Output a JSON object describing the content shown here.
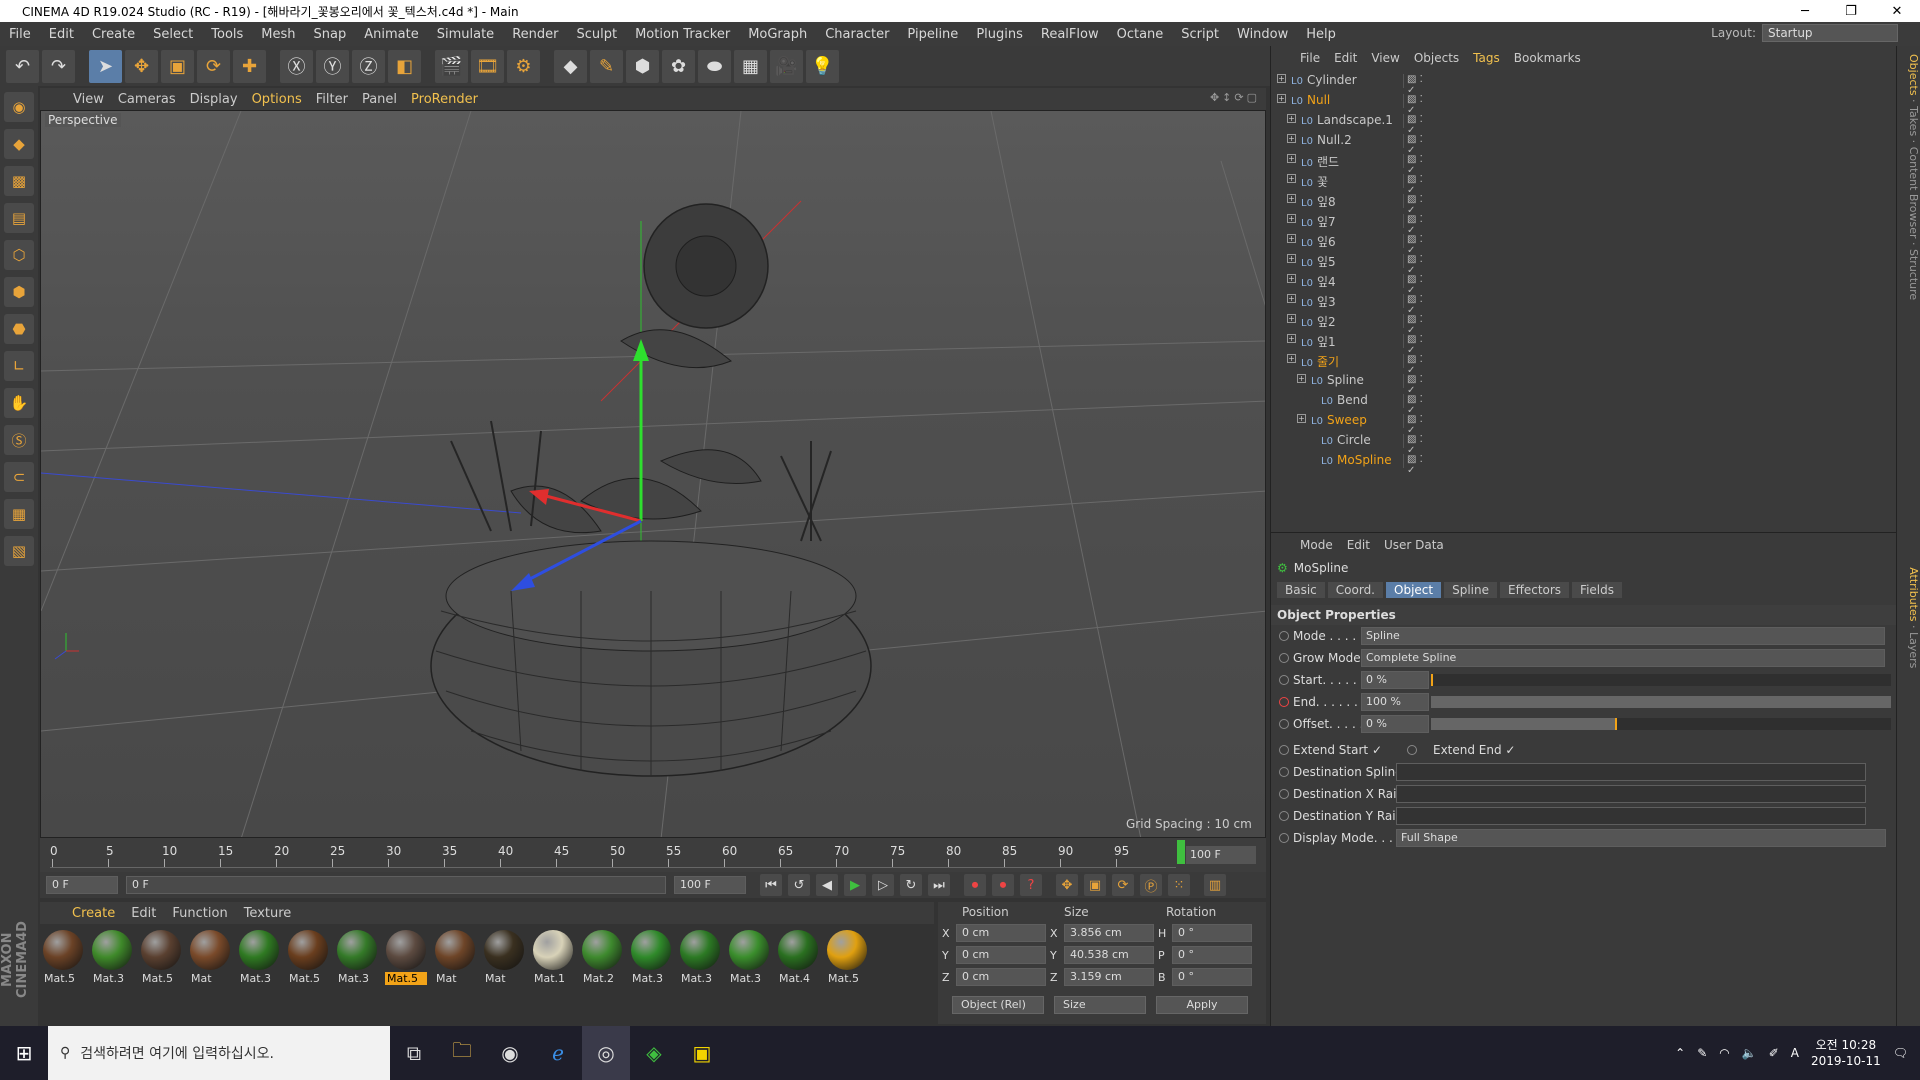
{
  "window": {
    "title": "CINEMA 4D R19.024 Studio (RC - R19) - [해바라기_꽃봉오리에서 꽃_텍스처.c4d *] - Main"
  },
  "menubar": {
    "items": [
      "File",
      "Edit",
      "Create",
      "Select",
      "Tools",
      "Mesh",
      "Snap",
      "Animate",
      "Simulate",
      "Render",
      "Sculpt",
      "Motion Tracker",
      "MoGraph",
      "Character",
      "Pipeline",
      "Plugins",
      "RealFlow",
      "Octane",
      "Script",
      "Window",
      "Help"
    ],
    "layout_label": "Layout:",
    "layout_value": "Startup"
  },
  "viewport": {
    "menu": [
      "View",
      "Cameras",
      "Display",
      "Options",
      "Filter",
      "Panel",
      "ProRender"
    ],
    "label": "Perspective",
    "grid_spacing": "Grid Spacing : 10 cm"
  },
  "timeline": {
    "ticks": [
      "0",
      "5",
      "10",
      "15",
      "20",
      "25",
      "30",
      "35",
      "40",
      "45",
      "50",
      "55",
      "60",
      "65",
      "70",
      "75",
      "80",
      "85",
      "90",
      "95"
    ],
    "end_field": "100 F",
    "current": "0 F",
    "range_start": "0 F",
    "range_end": "100 F",
    "max": "100 F"
  },
  "materials": {
    "menu": [
      "Create",
      "Edit",
      "Function",
      "Texture"
    ],
    "items": [
      {
        "name": "Mat.5",
        "color": "#6b4226"
      },
      {
        "name": "Mat.3",
        "color": "#3f8a2a"
      },
      {
        "name": "Mat.5",
        "color": "#5a4030"
      },
      {
        "name": "Mat",
        "color": "#7a4a2a"
      },
      {
        "name": "Mat.3",
        "color": "#2f7a22"
      },
      {
        "name": "Mat.5",
        "color": "#6a3e1e"
      },
      {
        "name": "Mat.3",
        "color": "#347a28"
      },
      {
        "name": "Mat.5",
        "color": "#5c4a40",
        "selected": true
      },
      {
        "name": "Mat",
        "color": "#6e4528"
      },
      {
        "name": "Mat",
        "color": "#3a3020"
      },
      {
        "name": "Mat.1",
        "color": "#d8d2b8"
      },
      {
        "name": "Mat.2",
        "color": "#3e8a2e"
      },
      {
        "name": "Mat.3",
        "color": "#2f8a2a"
      },
      {
        "name": "Mat.3",
        "color": "#2c7a24"
      },
      {
        "name": "Mat.3",
        "color": "#3a8e2c"
      },
      {
        "name": "Mat.4",
        "color": "#2a7020"
      },
      {
        "name": "Mat.5",
        "color": "#e0a010"
      }
    ]
  },
  "coords": {
    "headers": [
      "Position",
      "Size",
      "Rotation"
    ],
    "rows": [
      {
        "axis": "X",
        "pos": "0 cm",
        "saxis": "X",
        "size": "3.856 cm",
        "raxis": "H",
        "rot": "0 °"
      },
      {
        "axis": "Y",
        "pos": "0 cm",
        "saxis": "Y",
        "size": "40.538 cm",
        "raxis": "P",
        "rot": "0 °"
      },
      {
        "axis": "Z",
        "pos": "0 cm",
        "saxis": "Z",
        "size": "3.159 cm",
        "raxis": "B",
        "rot": "0 °"
      }
    ],
    "mode": "Object (Rel)",
    "size_mode": "Size",
    "apply": "Apply"
  },
  "objects": {
    "menu": [
      "File",
      "Edit",
      "View",
      "Objects",
      "Tags",
      "Bookmarks"
    ],
    "items": [
      {
        "name": "Cylinder",
        "depth": 0
      },
      {
        "name": "Null",
        "depth": 0,
        "hl": true
      },
      {
        "name": "Landscape.1",
        "depth": 1
      },
      {
        "name": "Null.2",
        "depth": 1
      },
      {
        "name": "랜드",
        "depth": 1
      },
      {
        "name": "꽃",
        "depth": 1
      },
      {
        "name": "잎8",
        "depth": 1
      },
      {
        "name": "잎7",
        "depth": 1
      },
      {
        "name": "잎6",
        "depth": 1
      },
      {
        "name": "잎5",
        "depth": 1
      },
      {
        "name": "잎4",
        "depth": 1
      },
      {
        "name": "잎3",
        "depth": 1
      },
      {
        "name": "잎2",
        "depth": 1
      },
      {
        "name": "잎1",
        "depth": 1
      },
      {
        "name": "줄기",
        "depth": 1,
        "hl": true
      },
      {
        "name": "Spline",
        "depth": 2
      },
      {
        "name": "Bend",
        "depth": 3
      },
      {
        "name": "Sweep",
        "depth": 2,
        "hl": true
      },
      {
        "name": "Circle",
        "depth": 3
      },
      {
        "name": "MoSpline",
        "depth": 3,
        "hl": true
      }
    ]
  },
  "attributes": {
    "menu": [
      "Mode",
      "Edit",
      "User Data"
    ],
    "object": "MoSpline",
    "tabs": [
      "Basic",
      "Coord.",
      "Object",
      "Spline",
      "Effectors",
      "Fields"
    ],
    "active_tab": "Object",
    "section": "Object Properties",
    "mode_label": "Mode . . . . .",
    "mode": "Spline",
    "grow_label": "Grow Mode",
    "grow": "Complete Spline",
    "start_label": "Start. . . . . .",
    "start": "0 %",
    "end_label": "End. . . . . . .",
    "end": "100 %",
    "offset_label": "Offset. . . . .",
    "offset": "0 %",
    "start_pct": 0,
    "end_pct": 100,
    "offset_pct": 40,
    "extend_start": "Extend Start ✓",
    "extend_end": "Extend End ✓",
    "dest_spline": "Destination Spline",
    "dest_x": "Destination X Rail",
    "dest_y": "Destination Y Rail",
    "display_label": "Display Mode. . . . .",
    "display": "Full Shape"
  },
  "side": {
    "labels": [
      "Objects",
      "Takes",
      "Content Browser",
      "Structure"
    ],
    "labels2": [
      "Attributes",
      "Layers"
    ]
  },
  "taskbar": {
    "search": "검색하려면 여기에 입력하십시오.",
    "time": "오전 10:28",
    "date": "2019-10-11",
    "ime": "A"
  }
}
